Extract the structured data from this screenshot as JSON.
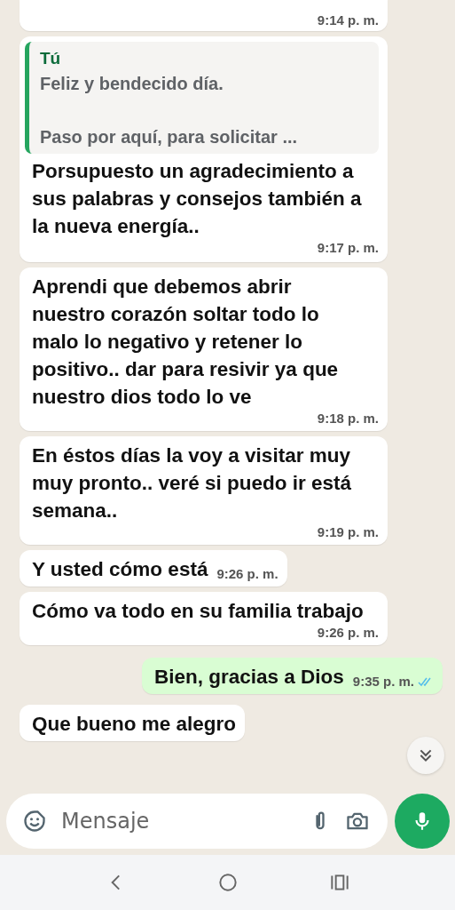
{
  "messages": [
    {
      "kind": "time_only",
      "outgoing": false,
      "time": "9:14 p. m."
    },
    {
      "kind": "reply",
      "outgoing": false,
      "quote": {
        "author": "Tú",
        "lines": [
          "Feliz y bendecido día.",
          "Paso por aquí, para solicitar ..."
        ]
      },
      "text": "Porsupuesto un agradecimiento a sus palabras y consejos también a la nueva energía..",
      "time": "9:17 p. m."
    },
    {
      "kind": "text",
      "outgoing": false,
      "text": "Aprendi que debemos abrir nuestro corazón soltar todo lo malo lo negativo y retener lo positivo.. dar para resivir ya que nuestro dios todo lo ve",
      "time": "9:18 p. m."
    },
    {
      "kind": "text",
      "outgoing": false,
      "text": "En éstos días la voy a visitar muy muy pronto.. veré si puedo ir está semana..",
      "time": "9:19 p. m."
    },
    {
      "kind": "text",
      "outgoing": false,
      "text": "Y usted cómo está",
      "time": "9:26 p. m."
    },
    {
      "kind": "text",
      "outgoing": false,
      "text": "Cómo va todo en su familia trabajo",
      "time": "9:26 p. m."
    },
    {
      "kind": "text",
      "outgoing": true,
      "read": true,
      "text": "Bien, gracias a Dios",
      "time": "9:35 p. m."
    },
    {
      "kind": "text",
      "outgoing": false,
      "text": "Que bueno me alegro"
    }
  ],
  "composer": {
    "placeholder": "Mensaje"
  }
}
